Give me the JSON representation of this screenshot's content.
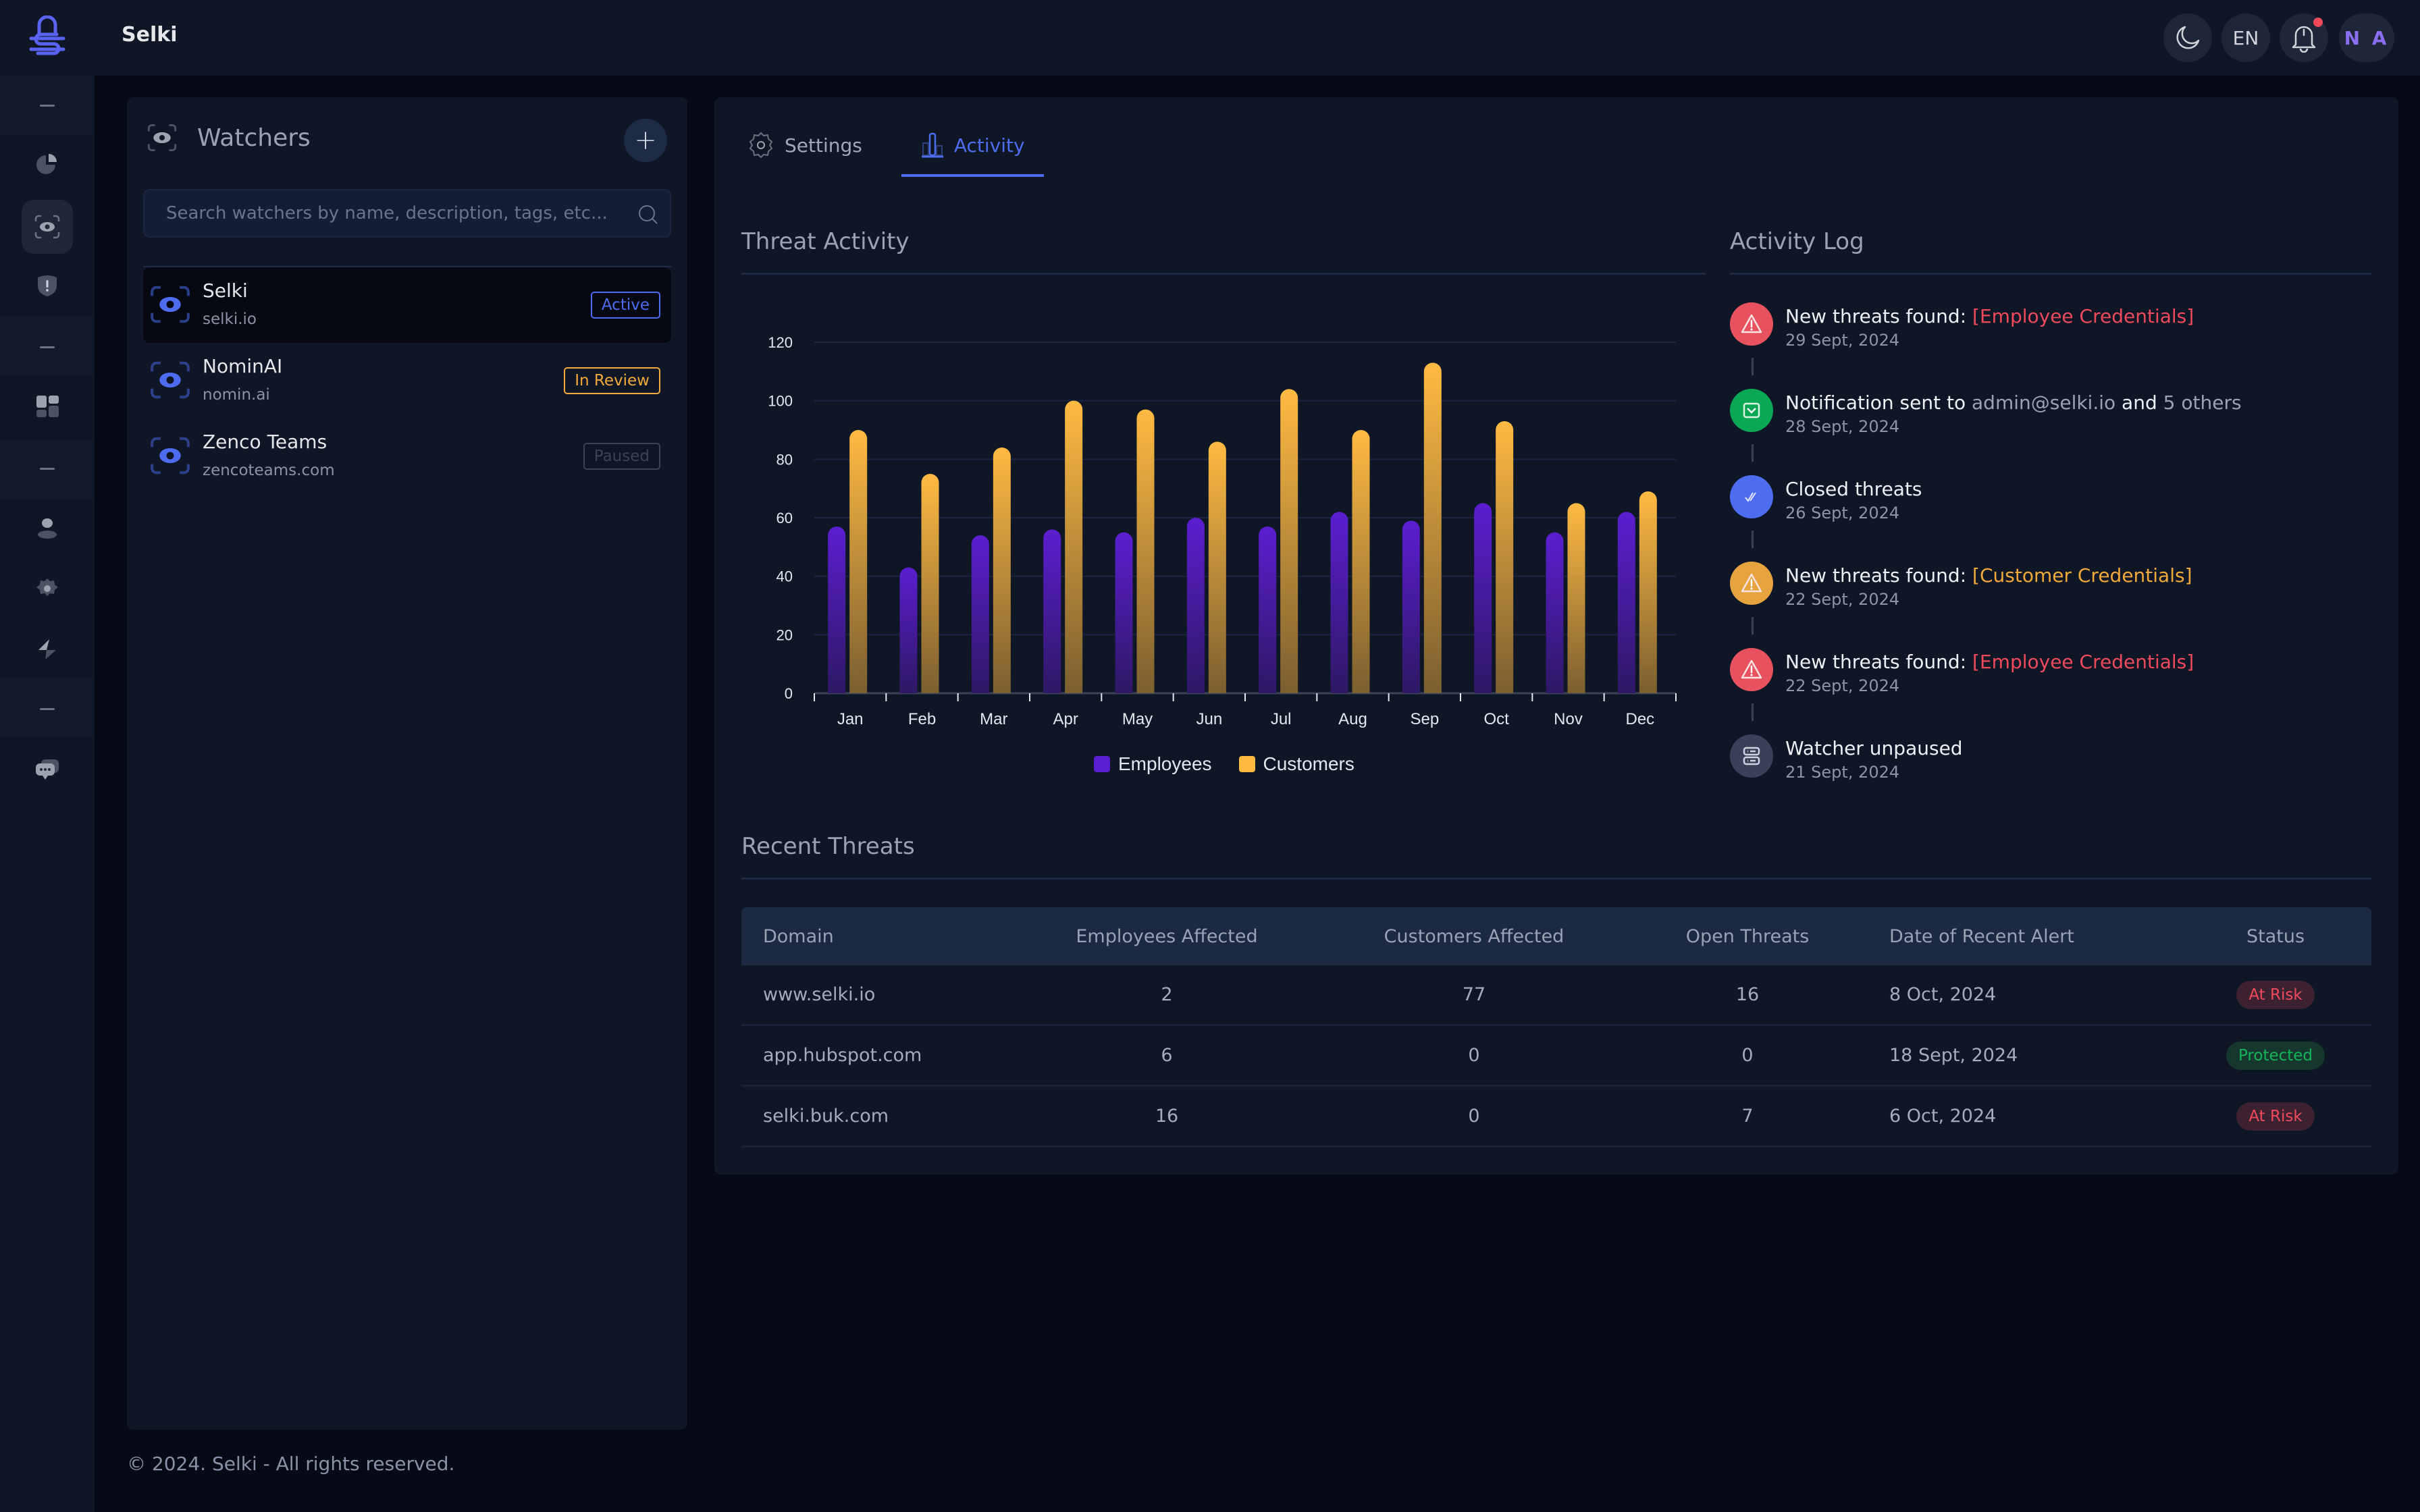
{
  "app": {
    "title": "Selki"
  },
  "header": {
    "theme_icon": "moon-icon",
    "language": "EN",
    "notifications_icon": "bell-icon",
    "has_unread_notifications": true,
    "avatar_initials": "N A"
  },
  "sidebar": {
    "items": [
      {
        "type": "divider"
      },
      {
        "icon": "pie-chart-icon"
      },
      {
        "icon": "watcher-eye-icon",
        "active": true
      },
      {
        "icon": "shield-alert-icon"
      },
      {
        "type": "divider"
      },
      {
        "icon": "dashboard-grid-icon"
      },
      {
        "type": "divider"
      },
      {
        "icon": "user-icon"
      },
      {
        "icon": "gear-icon"
      },
      {
        "icon": "lightning-icon"
      },
      {
        "type": "divider"
      },
      {
        "icon": "chat-icon"
      }
    ]
  },
  "watchers": {
    "title": "Watchers",
    "add_label": "+",
    "search_placeholder": "Search watchers by name, description, tags, etc...",
    "items": [
      {
        "name": "Selki",
        "domain": "selki.io",
        "status": "Active",
        "status_color": "#4d6cf0",
        "selected": true
      },
      {
        "name": "NominAI",
        "domain": "nomin.ai",
        "status": "In Review",
        "status_color": "#f0a93a",
        "selected": false
      },
      {
        "name": "Zenco Teams",
        "domain": "zencoteams.com",
        "status": "Paused",
        "status_color": "#3b4457",
        "selected": false
      }
    ]
  },
  "tabs": [
    {
      "label": "Settings",
      "icon": "gear-icon",
      "active": false
    },
    {
      "label": "Activity",
      "icon": "bar-chart-icon",
      "active": true
    }
  ],
  "threat_activity": {
    "title": "Threat Activity"
  },
  "chart_data": {
    "type": "bar",
    "title": "Threat Activity",
    "xlabel": "",
    "ylabel": "",
    "categories": [
      "Jan",
      "Feb",
      "Mar",
      "Apr",
      "May",
      "Jun",
      "Jul",
      "Aug",
      "Sep",
      "Oct",
      "Nov",
      "Dec"
    ],
    "series": [
      {
        "name": "Employees",
        "color": "#5b1ed0",
        "values": [
          57,
          43,
          54,
          56,
          55,
          60,
          57,
          62,
          59,
          65,
          55,
          62
        ]
      },
      {
        "name": "Customers",
        "color": "#ffba42",
        "values": [
          90,
          75,
          84,
          100,
          97,
          86,
          104,
          90,
          113,
          93,
          65,
          69
        ]
      }
    ],
    "ylim": [
      0,
      120
    ],
    "yticks": [
      0,
      20,
      40,
      60,
      80,
      100,
      120
    ],
    "grid": true,
    "legend": "bottom-center"
  },
  "activity_log": {
    "title": "Activity Log",
    "items": [
      {
        "icon": "warning-icon",
        "color": "#e8525f",
        "text": "New threats found: ",
        "highlight": "[Employee Credentials]",
        "highlight_color": "#ef4a5c",
        "date": "29 Sept, 2024"
      },
      {
        "icon": "mail-icon",
        "color": "#0aa854",
        "text": "Notification sent to ",
        "email": "admin@selki.io",
        "and": " and ",
        "others": "5 others",
        "date": "28 Sept, 2024"
      },
      {
        "icon": "double-check-icon",
        "color": "#4d6cf0",
        "text": "Closed threats",
        "date": "26 Sept, 2024"
      },
      {
        "icon": "warning-icon",
        "color": "#e6a33e",
        "text": "New threats found: ",
        "highlight": "[Customer Credentials]",
        "highlight_color": "#f0a93a",
        "date": "22 Sept, 2024"
      },
      {
        "icon": "warning-icon",
        "color": "#e8525f",
        "text": "New threats found: ",
        "highlight": "[Employee Credentials]",
        "highlight_color": "#ef4a5c",
        "date": "22 Sept, 2024"
      },
      {
        "icon": "server-icon",
        "color": "#3a4058",
        "text": "Watcher unpaused",
        "date": "21 Sept, 2024"
      }
    ]
  },
  "recent_threats": {
    "title": "Recent Threats",
    "columns": [
      "Domain",
      "Employees Affected",
      "Customers Affected",
      "Open Threats",
      "Date of Recent Alert",
      "Status"
    ],
    "rows": [
      {
        "domain": "www.selki.io",
        "employees": "2",
        "customers": "77",
        "open": "16",
        "date": "8 Oct, 2024",
        "status": "At Risk"
      },
      {
        "domain": "app.hubspot.com",
        "employees": "6",
        "customers": "0",
        "open": "0",
        "date": "18 Sept, 2024",
        "status": "Protected"
      },
      {
        "domain": "selki.buk.com",
        "employees": "16",
        "customers": "0",
        "open": "7",
        "date": "6 Oct, 2024",
        "status": "At Risk"
      }
    ]
  },
  "footer": {
    "text": "© 2024. Selki - All rights reserved."
  }
}
